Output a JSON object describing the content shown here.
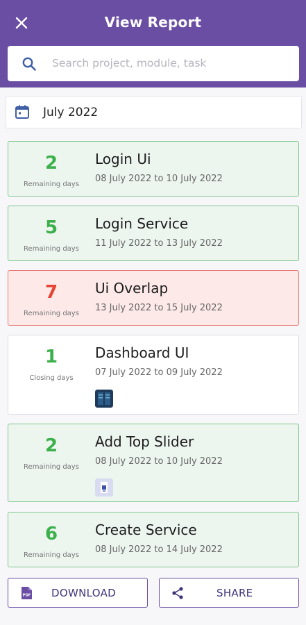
{
  "header": {
    "title": "View Report"
  },
  "search": {
    "placeholder": "Search project, module, task"
  },
  "filter": {
    "month_label": "July 2022"
  },
  "tasks": [
    {
      "count": "2",
      "count_label": "Remaining days",
      "name": "Login Ui",
      "range": "08 July 2022 to 10 July 2022",
      "status": "green"
    },
    {
      "count": "5",
      "count_label": "Remaining days",
      "name": "Login Service",
      "range": "11 July 2022 to 13 July 2022",
      "status": "green"
    },
    {
      "count": "7",
      "count_label": "Remaining days",
      "name": "Ui Overlap",
      "range": "13 July 2022 to 15 July 2022",
      "status": "red"
    },
    {
      "count": "1",
      "count_label": "Closing days",
      "name": "Dashboard UI",
      "range": "07 July 2022 to 09 July 2022",
      "status": "white"
    },
    {
      "count": "2",
      "count_label": "Remaining days",
      "name": "Add Top Slider",
      "range": "08 July 2022 to 10 July 2022",
      "status": "green"
    },
    {
      "count": "6",
      "count_label": "Remaining days",
      "name": "Create Service",
      "range": "08 July 2022 to 14 July 2022",
      "status": "green"
    }
  ],
  "actions": {
    "download_label": "DOWNLOAD",
    "share_label": "SHARE",
    "pdf_icon_text": "PDF"
  },
  "colors": {
    "brand": "#6a4ea3",
    "green": "#3cb04a",
    "red": "#e64535"
  }
}
